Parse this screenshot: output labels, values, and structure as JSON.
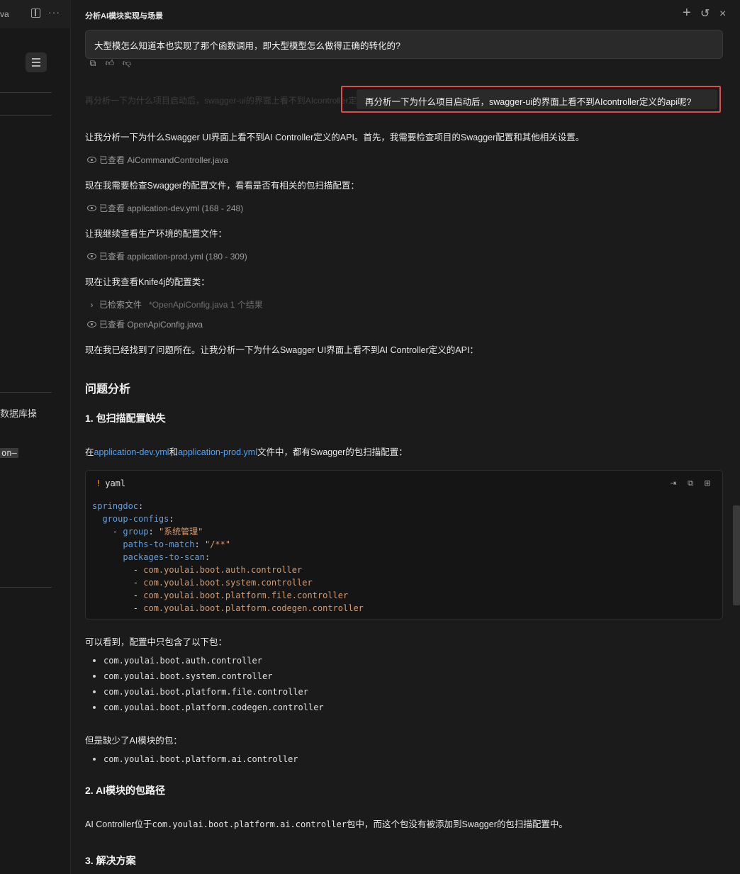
{
  "left_pane": {
    "tab_name": "va",
    "more": "···",
    "text_1": "数据库操",
    "text_2": "on–"
  },
  "header": {
    "title": "分析AI模块实现与场景",
    "new_label": "+",
    "history_label": "↺",
    "close_label": "×"
  },
  "messages": {
    "user_question": "大型模怎么知道本也实现了那个函数调用，即大型模型怎么做得正确的转化的?",
    "faded_text": "再分析一下为什么项目启动后，swagger-ui的界面上看不到AIcontroller定义的api呢?",
    "followup": "再分析一下为什么项目启动后，swagger-ui的界面上看不到AIcontroller定义的api呢?"
  },
  "response": {
    "p1": "让我分析一下为什么Swagger UI界面上看不到AI Controller定义的API。首先，我需要检查项目的Swagger配置和其他相关设置。",
    "tool1": "已查看 AiCommandController.java",
    "p2": "现在我需要检查Swagger的配置文件，看看是否有相关的包扫描配置：",
    "tool2": "已查看 application-dev.yml (168 - 248)",
    "p3": "让我继续查看生产环境的配置文件：",
    "tool3": "已查看 application-prod.yml (180 - 309)",
    "p4": "现在让我查看Knife4j的配置类：",
    "tool4_label": "已检索文件",
    "tool4_detail": "*OpenApiConfig.java 1 个结果",
    "tool5": "已查看 OpenApiConfig.java",
    "p5": "现在我已经找到了问题所在。让我分析一下为什么Swagger UI界面上看不到AI Controller定义的API：",
    "h_analysis": "问题分析",
    "h1": "1. 包扫描配置缺失",
    "p6_pre": "在",
    "p6_link1": "application-dev.yml",
    "p6_mid": "和",
    "p6_link2": "application-prod.yml",
    "p6_post": "文件中，都有Swagger的包扫描配置：",
    "code_lang": "yaml",
    "code_bang": "!",
    "code": {
      "l1_key": "springdoc",
      "l2_key": "group-configs",
      "l3_key": "group",
      "l3_val": "\"系统管理\"",
      "l4_key": "paths-to-match",
      "l4_val": "\"/**\"",
      "l5_key": "packages-to-scan",
      "pkgs": [
        "com.youlai.boot.auth.controller",
        "com.youlai.boot.system.controller",
        "com.youlai.boot.platform.file.controller",
        "com.youlai.boot.platform.codegen.controller"
      ]
    },
    "p7": "可以看到，配置中只包含了以下包：",
    "included": [
      "com.youlai.boot.auth.controller",
      "com.youlai.boot.system.controller",
      "com.youlai.boot.platform.file.controller",
      "com.youlai.boot.platform.codegen.controller"
    ],
    "p8": "但是缺少了AI模块的包：",
    "missing": [
      "com.youlai.boot.platform.ai.controller"
    ],
    "h2": "2. AI模块的包路径",
    "p9_pre": "AI Controller位于",
    "p9_code": "com.youlai.boot.platform.ai.controller",
    "p9_post": "包中，而这个包没有被添加到Swagger的包扫描配置中。",
    "h3": "3. 解决方案"
  }
}
